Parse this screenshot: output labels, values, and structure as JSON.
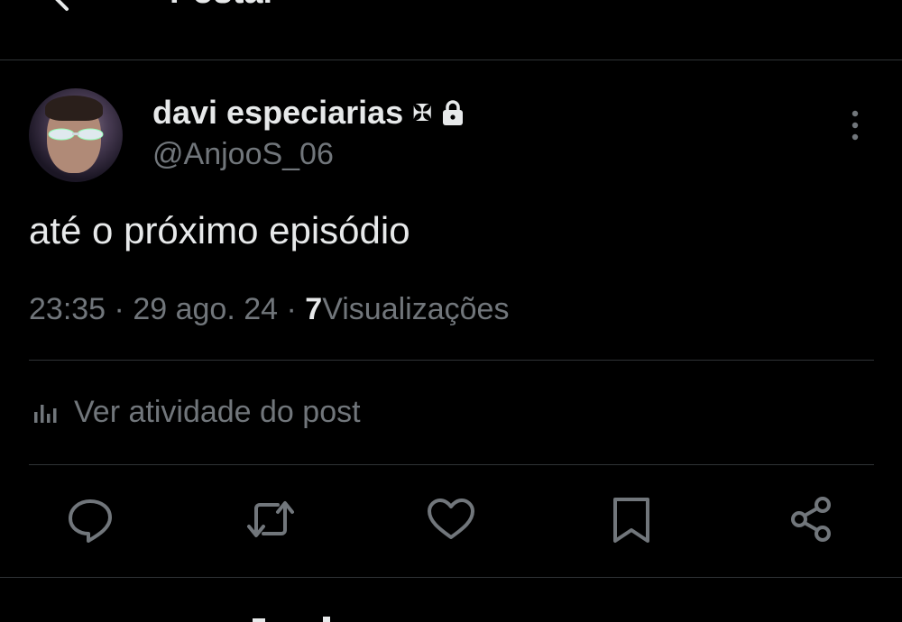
{
  "header": {
    "title": "Postar",
    "back_icon": "arrow-left-icon"
  },
  "post": {
    "author": {
      "display_name": "davi especiarias",
      "badge_symbol": "✠",
      "protected_icon": "lock-icon",
      "handle": "@AnjooS_06"
    },
    "text": "até o próximo episódio",
    "time": "23:35",
    "separator": "·",
    "date": "29 ago. 24",
    "views_count": "7",
    "views_label": "Visualizações",
    "activity_label": "Ver atividade do post"
  },
  "actions": [
    {
      "name": "reply-button",
      "icon": "reply-icon"
    },
    {
      "name": "repost-button",
      "icon": "repost-icon"
    },
    {
      "name": "like-button",
      "icon": "heart-icon"
    },
    {
      "name": "bookmark-button",
      "icon": "bookmark-icon"
    },
    {
      "name": "share-button",
      "icon": "share-icon"
    }
  ],
  "colors": {
    "background": "#000000",
    "text_primary": "#e7e9ea",
    "text_secondary": "#71767b",
    "divider": "#2f3336"
  }
}
